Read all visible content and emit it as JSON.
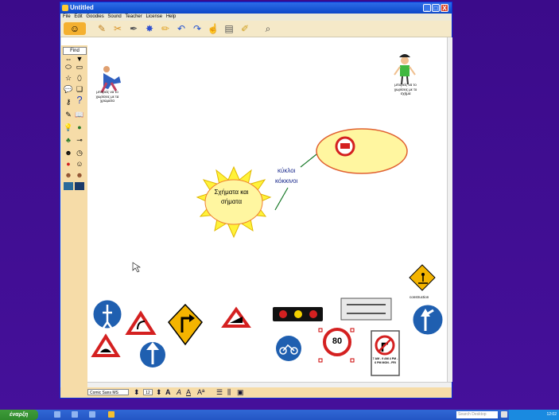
{
  "window": {
    "title": "Untitled",
    "buttons": [
      "_",
      "□",
      "X"
    ]
  },
  "menu": [
    "File",
    "Edit",
    "Goodies",
    "Sound",
    "Teacher",
    "License",
    "Help"
  ],
  "toolbar": {
    "icons": [
      "smiley-icon",
      "pencil-icon",
      "scissors-icon",
      "pen-icon",
      "splat-icon",
      "crayon-icon",
      "undo-icon",
      "redo-icon",
      "hand-icon",
      "book-icon",
      "brush-icon",
      "magnifier-icon"
    ]
  },
  "palette": {
    "find_label": "Find"
  },
  "canvas": {
    "left_caption": "μπορείς να το χωρίσεις με τα χρώματα",
    "right_caption": "μπορείς να το χωρίσεις με το σχήμα",
    "center_topic": "Σχήματα και σήματα",
    "link_label_line1": "κύκλοι",
    "link_label_line2": "κόκκινοι",
    "construction_label": "construction",
    "speed_sign": "80",
    "time_sign_text": "7 AM - 9 AM 4 PM - 6 PM MON - FRI"
  },
  "format_bar": {
    "font": "Comic Sans MS",
    "size": "12"
  },
  "taskbar": {
    "start_label": "έναρξη",
    "search_placeholder": "Search Desktop",
    "clock": "12:02"
  },
  "colors": {
    "desktop": "#3c0d8c",
    "sun": "#fff23a",
    "bubble": "#fff6a0",
    "sign_red": "#d42020",
    "sign_blue": "#1f5fb0"
  }
}
